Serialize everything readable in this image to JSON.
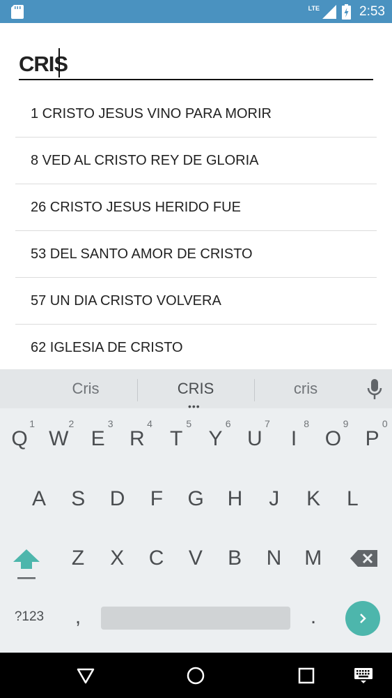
{
  "status_bar": {
    "network": "LTE",
    "time": "2:53"
  },
  "search": {
    "value": "CRIS"
  },
  "results": [
    "1 CRISTO JESUS VINO PARA MORIR",
    "8 VED AL CRISTO REY DE GLORIA",
    "26 CRISTO JESUS HERIDO FUE",
    "53 DEL SANTO AMOR DE CRISTO",
    "57 UN DIA CRISTO VOLVERA",
    "62 IGLESIA DE CRISTO"
  ],
  "keyboard": {
    "suggestions": [
      "Cris",
      "CRIS",
      "cris"
    ],
    "row1": [
      {
        "label": "Q",
        "hint": "1"
      },
      {
        "label": "W",
        "hint": "2"
      },
      {
        "label": "E",
        "hint": "3"
      },
      {
        "label": "R",
        "hint": "4"
      },
      {
        "label": "T",
        "hint": "5"
      },
      {
        "label": "Y",
        "hint": "6"
      },
      {
        "label": "U",
        "hint": "7"
      },
      {
        "label": "I",
        "hint": "8"
      },
      {
        "label": "O",
        "hint": "9"
      },
      {
        "label": "P",
        "hint": "0"
      }
    ],
    "row2": [
      "A",
      "S",
      "D",
      "F",
      "G",
      "H",
      "J",
      "K",
      "L"
    ],
    "row3": [
      "Z",
      "X",
      "C",
      "V",
      "B",
      "N",
      "M"
    ],
    "symbols_label": "?123",
    "comma": ",",
    "period": ".",
    "icons": {
      "mic": "mic-icon",
      "shift": "shift-icon",
      "backspace": "backspace-icon",
      "go": "arrow-right-icon"
    },
    "accent_color": "#4db6ac"
  },
  "colors": {
    "status_bar": "#4a92c0",
    "keyboard_bg": "#eceff1"
  }
}
